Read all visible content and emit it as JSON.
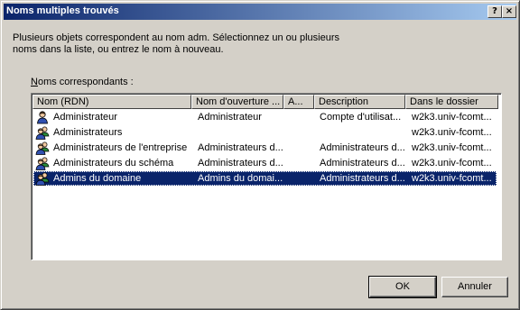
{
  "window": {
    "title": "Noms multiples trouvés",
    "help_label": "?",
    "close_label": "×"
  },
  "prompt": "Plusieurs objets correspondent au nom adm. Sélectionnez un ou plusieurs\nnoms dans la liste, ou entrez le nom à nouveau.",
  "list": {
    "label_prefix": "N",
    "label_rest": "oms correspondants :",
    "columns": [
      "Nom (RDN)",
      "Nom d'ouverture ...",
      "A...",
      "Description",
      "Dans le dossier"
    ],
    "rows": [
      {
        "icon": "user-icon",
        "name": "Administrateur",
        "logon": "Administrateur",
        "a": "",
        "description": "Compte d'utilisat...",
        "folder": "w2k3.univ-fcomt...",
        "selected": false
      },
      {
        "icon": "group-icon",
        "name": "Administrateurs",
        "logon": "",
        "a": "",
        "description": "",
        "folder": "w2k3.univ-fcomt...",
        "selected": false
      },
      {
        "icon": "group-icon",
        "name": "Administrateurs de l'entreprise",
        "logon": "Administrateurs d...",
        "a": "",
        "description": "Administrateurs d...",
        "folder": "w2k3.univ-fcomt...",
        "selected": false
      },
      {
        "icon": "group-icon",
        "name": "Administrateurs du schéma",
        "logon": "Administrateurs d...",
        "a": "",
        "description": "Administrateurs d...",
        "folder": "w2k3.univ-fcomt...",
        "selected": false
      },
      {
        "icon": "group-icon",
        "name": "Admins du domaine",
        "logon": "Admins du domai...",
        "a": "",
        "description": "Administrateurs d...",
        "folder": "w2k3.univ-fcomt...",
        "selected": true
      }
    ]
  },
  "buttons": {
    "ok": "OK",
    "cancel": "Annuler"
  }
}
